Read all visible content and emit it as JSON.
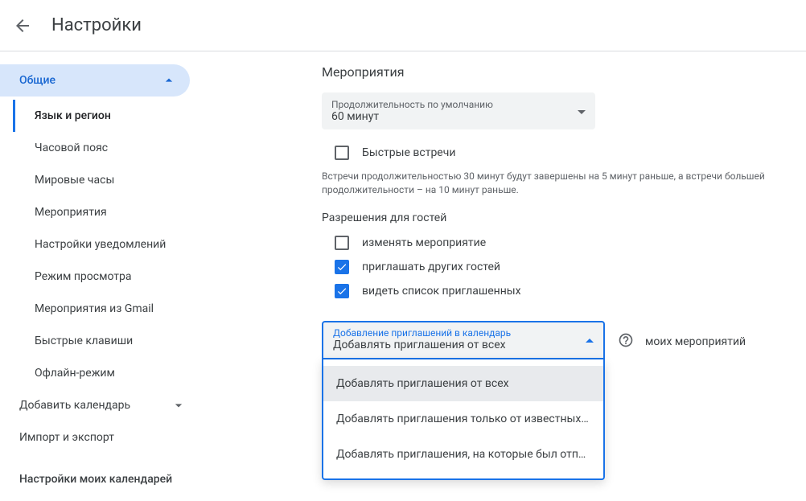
{
  "header": {
    "title": "Настройки"
  },
  "sidebar": {
    "group_label": "Общие",
    "items": [
      "Язык и регион",
      "Часовой пояс",
      "Мировые часы",
      "Мероприятия",
      "Настройки уведомлений",
      "Режим просмотра",
      "Мероприятия из Gmail",
      "Быстрые клавиши",
      "Офлайн-режим"
    ],
    "add_calendar": "Добавить календарь",
    "import_export": "Импорт и экспорт",
    "my_calendars_title": "Настройки моих календарей"
  },
  "content": {
    "section_title": "Мероприятия",
    "duration": {
      "label": "Продолжительность по умолчанию",
      "value": "60 минут"
    },
    "speedy": {
      "label": "Быстрые встречи",
      "help": "Встречи продолжительностью 30 минут будут завершены на 5 минут раньше, а встречи большей продолжительности – на 10 минут раньше."
    },
    "guest_perm_heading": "Разрешения для гостей",
    "perm_modify": "изменять мероприятие",
    "perm_invite": "приглашать других гостей",
    "perm_see": "видеть список приглашенных",
    "add_invites": {
      "label": "Добавление приглашений в календарь",
      "value": "Добавлять приглашения от всех",
      "options": [
        "Добавлять приглашения от всех",
        "Добавлять приглашения только от известных ...",
        "Добавлять приглашения, на которые был отпр..."
      ]
    },
    "trailing": "моих мероприятий"
  }
}
